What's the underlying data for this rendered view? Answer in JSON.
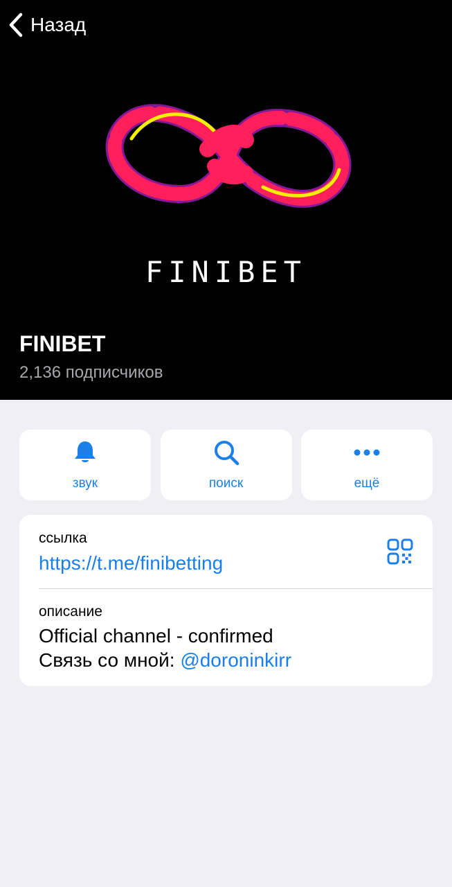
{
  "nav": {
    "back_label": "Назад"
  },
  "header": {
    "logo_text": "FINIBET",
    "channel_name": "FINIBET",
    "subscribers": "2,136 подписчиков"
  },
  "actions": [
    {
      "label": "звук",
      "icon": "bell-icon"
    },
    {
      "label": "поиск",
      "icon": "search-icon"
    },
    {
      "label": "ещё",
      "icon": "more-dots-icon"
    }
  ],
  "info": {
    "link_label": "ссылка",
    "link_value": "https://t.me/finibetting",
    "qr_icon": "qr-code-icon",
    "description_label": "описание",
    "description_line1": "Official channel - confirmed",
    "description_line2_prefix": "Связь со мной: ",
    "description_mention": "@doroninkirr"
  },
  "colors": {
    "accent": "#1a7fe8",
    "header_bg": "#000000",
    "page_bg": "#efeff4",
    "logo_red": "#ff1f5a",
    "logo_yellow": "#f4f000",
    "logo_purple": "#b020c8"
  }
}
